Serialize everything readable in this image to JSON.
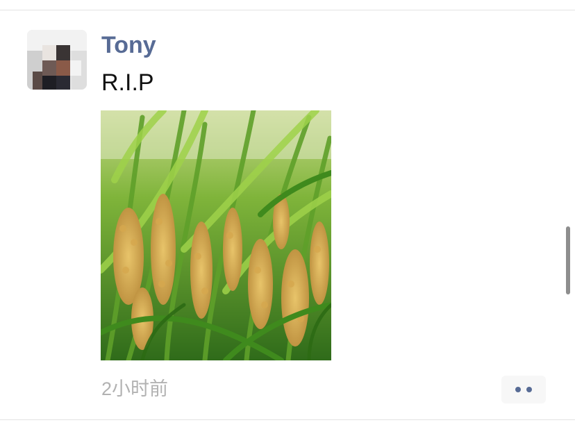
{
  "post": {
    "author": "Tony",
    "text": "R.I.P",
    "timestamp": "2小时前",
    "photo_description": "rice-paddy-photo",
    "avatar": "blurred-avatar"
  },
  "icons": {
    "more": "more-dots-icon"
  },
  "colors": {
    "author_name": "#576b95",
    "timestamp": "#b2b2b2",
    "more_dots": "#576b95",
    "divider": "#e3e3e3"
  }
}
